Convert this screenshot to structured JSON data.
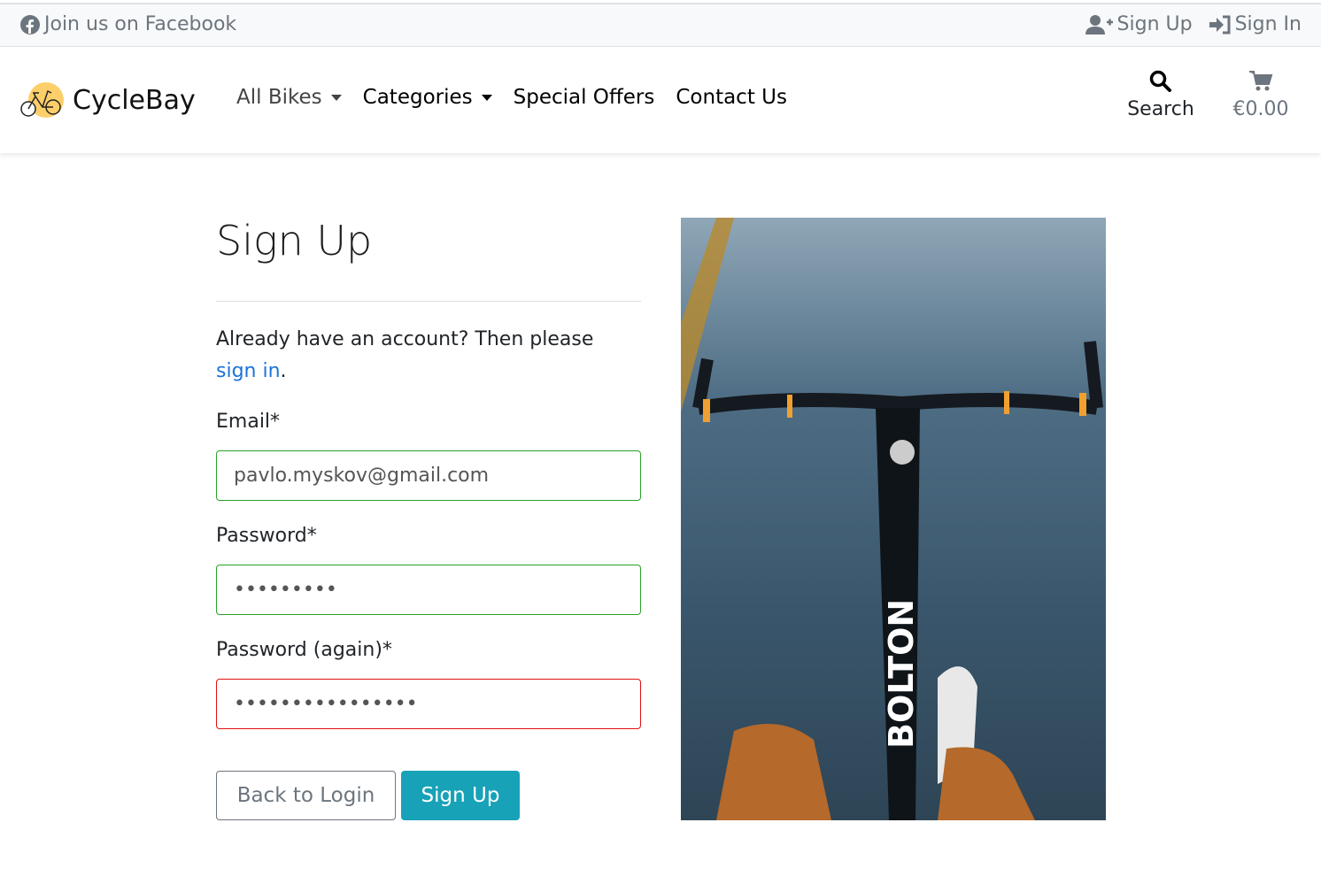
{
  "topbar": {
    "facebook": "Join us on Facebook",
    "signup": "Sign Up",
    "signin": "Sign In"
  },
  "brand": {
    "name": "CycleBay",
    "logo_color": "#fdcf6a"
  },
  "nav": {
    "items": [
      {
        "label": "All Bikes",
        "dropdown": true
      },
      {
        "label": "Categories",
        "dropdown": true
      },
      {
        "label": "Special Offers"
      },
      {
        "label": "Contact Us"
      }
    ],
    "search": "Search",
    "cart": "€0.00"
  },
  "form": {
    "title": "Sign Up",
    "intro": "Already have an account? Then please ",
    "link": "sign in",
    "intro_end": ".",
    "email_label": "Email*",
    "email_value": "pavlo.myskov@gmail.com",
    "password_label": "Password*",
    "password_value": "xxxxxxxxx",
    "password2_label": "Password (again)*",
    "password2_value": "xxxxxxxxxxxxxxxx",
    "back": "Back to Login",
    "submit": "Sign Up"
  },
  "photo": {
    "bike_text": "BOLTON"
  },
  "colors": {
    "accent": "#17a2b8",
    "valid": "#28a328",
    "invalid": "#e01010",
    "link": "#1a73d9"
  }
}
